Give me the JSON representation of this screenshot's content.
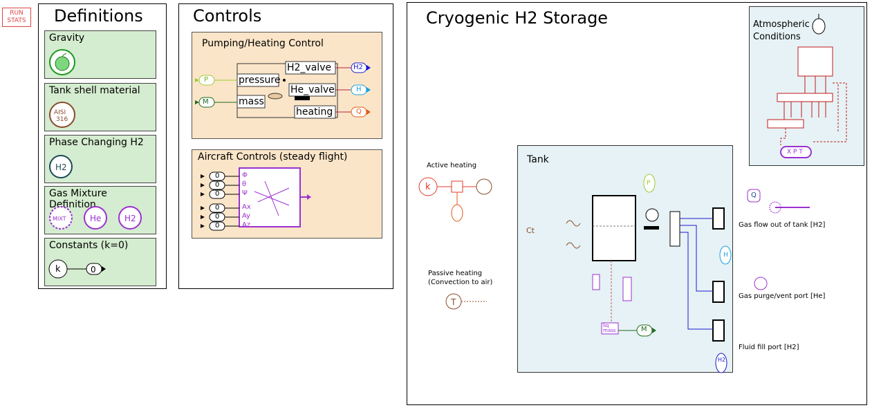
{
  "run_stats": {
    "line1": "RUN",
    "line2": "STATS"
  },
  "definitions": {
    "title": "Definitions",
    "cards": [
      {
        "label": "Gravity",
        "icon": "apple-icon"
      },
      {
        "label": "Tank shell material",
        "icon_text1": "AISI",
        "icon_text2": "316"
      },
      {
        "label": "Phase Changing H2",
        "icon_text": "H2"
      },
      {
        "label": "Gas Mixture Definition",
        "icons": [
          "MIXT",
          "He",
          "H2"
        ]
      },
      {
        "label": "Constants (k=0)",
        "k": "k",
        "zero": "0"
      }
    ]
  },
  "controls": {
    "title": "Controls",
    "pumping": {
      "title": "Pumping/Heating Control",
      "inputs": [
        "P",
        "M"
      ],
      "input_labels": [
        "pressure",
        "mass"
      ],
      "outputs": [
        "H2_valve",
        "He_valve",
        "heating"
      ],
      "output_ports": [
        "H2",
        "H",
        "Q"
      ]
    },
    "aircraft": {
      "title": "Aircraft Controls (steady flight)",
      "zeros": [
        "0",
        "0",
        "0",
        "0",
        "0",
        "0"
      ],
      "angles": [
        "Φ",
        "θ",
        "Ψ"
      ],
      "accels": [
        "Ax",
        "Ay",
        "Az"
      ]
    }
  },
  "storage": {
    "title": "Cryogenic H2 Storage",
    "atmospheric": {
      "title_line1": "Atmospheric",
      "title_line2": "Conditions",
      "port_letters": "X P T"
    },
    "tank": {
      "title": "Tank",
      "ct": "Ct"
    },
    "active_heating": {
      "label": "Active heating",
      "k": "k"
    },
    "passive_heating": {
      "line1": "Passive heating",
      "line2": "(Convection to air)",
      "t": "T"
    },
    "gas_out": "Gas flow out of tank [H2]",
    "purge": "Gas purge/vent port [He]",
    "fill": "Fluid fill port [H2]",
    "liq_mass": {
      "l1": "liq",
      "l2": "mass",
      "m": "M"
    },
    "p_sensor": "P",
    "q_label": "Q",
    "h_label": "H",
    "h2_label": "H2"
  }
}
